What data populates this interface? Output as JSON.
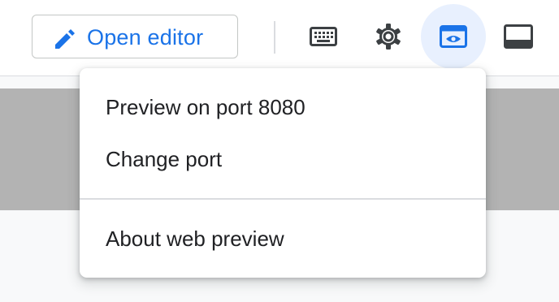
{
  "toolbar": {
    "open_editor_label": "Open editor",
    "icons": [
      "pencil-icon",
      "keyboard-icon",
      "gear-icon",
      "web-preview-icon",
      "panel-icon"
    ]
  },
  "menu": {
    "items": [
      {
        "label": "Preview on port 8080"
      },
      {
        "label": "Change port"
      },
      {
        "label": "About web preview"
      }
    ]
  },
  "colors": {
    "accent": "#1a73e8",
    "active_button_bg": "#e8f0fe",
    "overlay_gray": "#b3b3b3"
  }
}
